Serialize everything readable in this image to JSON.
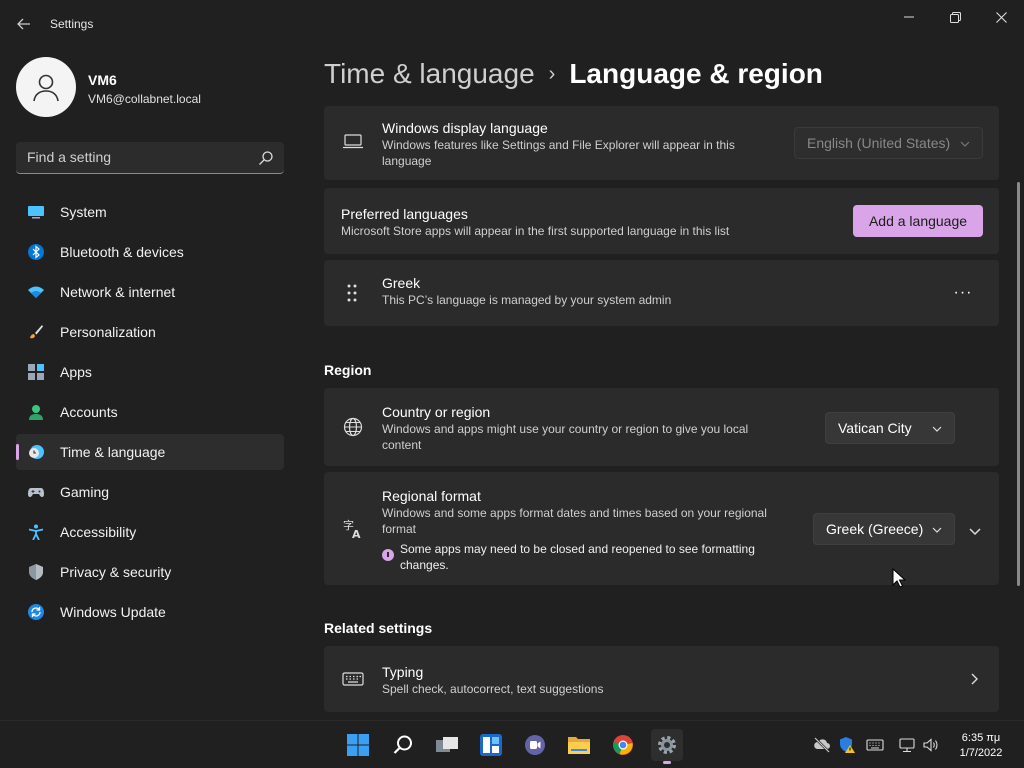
{
  "window": {
    "title": "Settings"
  },
  "profile": {
    "name": "VM6",
    "email": "VM6@collabnet.local"
  },
  "search": {
    "placeholder": "Find a setting"
  },
  "sidebar": {
    "items": [
      {
        "label": "System",
        "icon": "monitor-icon"
      },
      {
        "label": "Bluetooth & devices",
        "icon": "bluetooth-icon"
      },
      {
        "label": "Network & internet",
        "icon": "wifi-icon"
      },
      {
        "label": "Personalization",
        "icon": "brush-icon"
      },
      {
        "label": "Apps",
        "icon": "apps-icon"
      },
      {
        "label": "Accounts",
        "icon": "person-icon"
      },
      {
        "label": "Time & language",
        "icon": "clock-globe-icon",
        "active": true
      },
      {
        "label": "Gaming",
        "icon": "gamepad-icon"
      },
      {
        "label": "Accessibility",
        "icon": "accessibility-icon"
      },
      {
        "label": "Privacy & security",
        "icon": "shield-icon"
      },
      {
        "label": "Windows Update",
        "icon": "update-icon"
      }
    ]
  },
  "breadcrumb": {
    "parent": "Time & language",
    "separator": "›",
    "current": "Language & region"
  },
  "display_language": {
    "title": "Windows display language",
    "desc": "Windows features like Settings and File Explorer will appear in this language",
    "value": "English (United States)",
    "disabled": true
  },
  "preferred_languages": {
    "title": "Preferred languages",
    "desc": "Microsoft Store apps will appear in the first supported language in this list",
    "button": "Add a language"
  },
  "language_item": {
    "title": "Greek",
    "desc": "This PC’s language is managed by your system admin",
    "more": "···"
  },
  "region": {
    "heading": "Region",
    "country": {
      "title": "Country or region",
      "desc": "Windows and apps might use your country or region to give you local content",
      "value": "Vatican City"
    },
    "format": {
      "title": "Regional format",
      "desc": "Windows and some apps format dates and times based on your regional format",
      "value": "Greek (Greece)",
      "note": "Some apps may need to be closed and reopened to see formatting changes."
    }
  },
  "related": {
    "heading": "Related settings",
    "typing": {
      "title": "Typing",
      "desc": "Spell check, autocorrect, text suggestions"
    }
  },
  "taskbar": {
    "apps": [
      "start-icon",
      "search-icon",
      "task-view-icon",
      "widgets-icon",
      "teams-chat-icon",
      "file-explorer-icon",
      "chrome-icon",
      "settings-icon"
    ],
    "active_app": "settings-icon",
    "clock": {
      "time": "6:35 πμ",
      "date": "1/7/2022"
    }
  },
  "colors": {
    "accent": "#d9a5e8",
    "background": "#202020",
    "card": "#2b2b2b"
  }
}
